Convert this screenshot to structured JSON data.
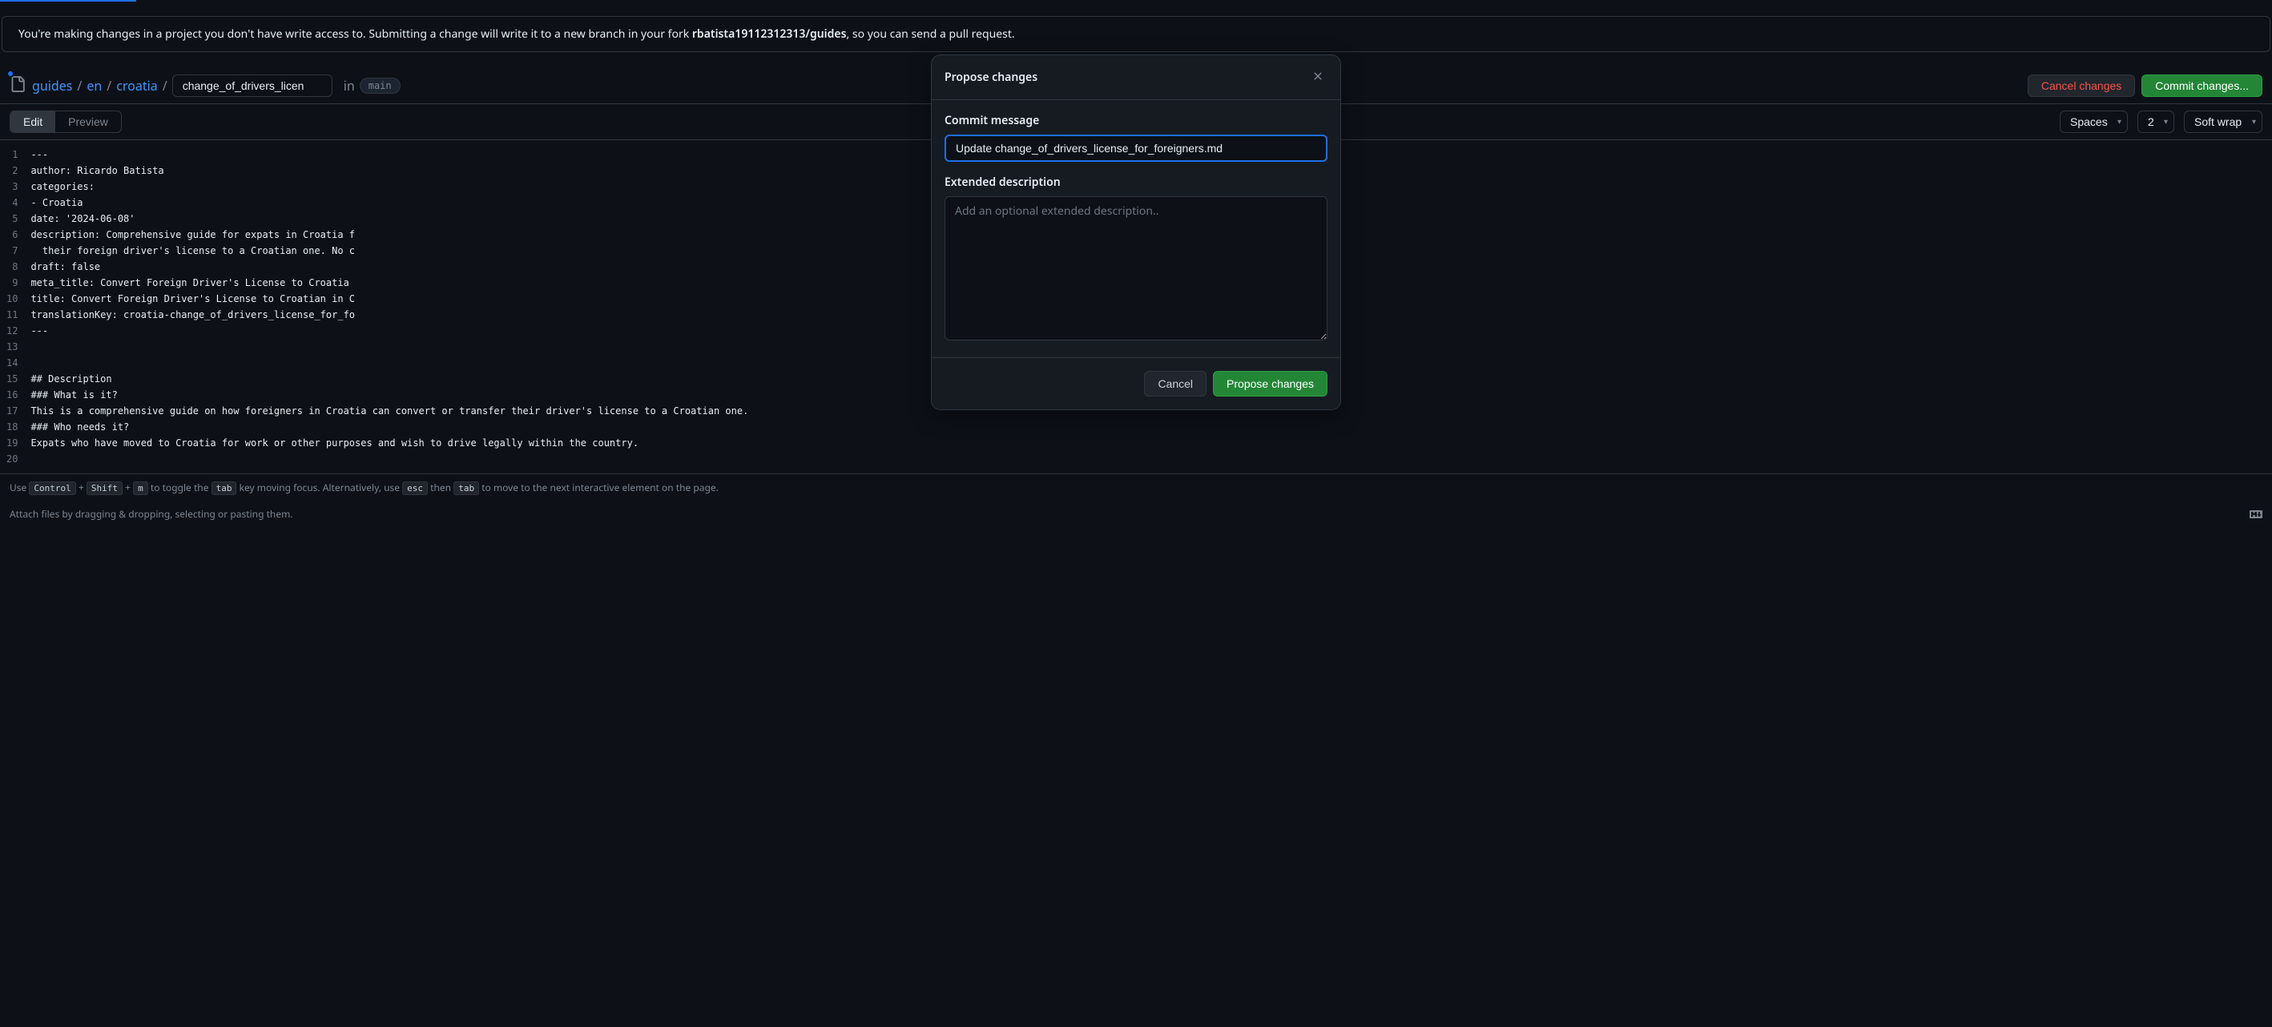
{
  "alert": {
    "prefix": "You're making changes in a project you don't have write access to. Submitting a change will write it to a new branch in your fork ",
    "fork": "rbatista19112312313/guides",
    "suffix": ", so you can send a pull request."
  },
  "breadcrumb": {
    "repo": "guides",
    "path1": "en",
    "path2": "croatia",
    "filename": "change_of_drivers_licen",
    "in_label": "in",
    "branch": "main"
  },
  "actions": {
    "cancel_changes": "Cancel changes",
    "commit_changes": "Commit changes..."
  },
  "tabs": {
    "edit": "Edit",
    "preview": "Preview"
  },
  "toolbar": {
    "spaces": "Spaces",
    "indent": "2",
    "wrap": "Soft wrap"
  },
  "editor": {
    "lines": [
      "---",
      "author: Ricardo Batista",
      "categories:",
      "- Croatia",
      "date: '2024-06-08'",
      "description: Comprehensive guide for expats in Croatia f",
      "  their foreign driver's license to a Croatian one. No c",
      "draft: false",
      "meta_title: Convert Foreign Driver's License to Croatia",
      "title: Convert Foreign Driver's License to Croatian in C",
      "translationKey: croatia-change_of_drivers_license_for_fo",
      "---",
      "",
      "",
      "## Description",
      "### What is it?",
      "This is a comprehensive guide on how foreigners in Croatia can convert or transfer their driver's license to a Croatian one.",
      "### Who needs it?",
      "Expats who have moved to Croatia for work or other purposes and wish to drive legally within the country.",
      ""
    ]
  },
  "hint": {
    "use": "Use ",
    "k1": "Control",
    "plus": "+",
    "k2": "Shift",
    "k3": "m",
    "toggle": " to toggle the ",
    "k4": "tab",
    "moving": " key moving focus. Alternatively, use ",
    "k5": "esc",
    "then": " then ",
    "k6": "tab",
    "move": " to move to the next interactive element on the page."
  },
  "attach": "Attach files by dragging & dropping, selecting or pasting them.",
  "modal": {
    "title": "Propose changes",
    "commit_message_label": "Commit message",
    "commit_message_value": "Update change_of_drivers_license_for_foreigners.md",
    "extended_label": "Extended description",
    "extended_placeholder": "Add an optional extended description..",
    "cancel": "Cancel",
    "propose": "Propose changes"
  }
}
